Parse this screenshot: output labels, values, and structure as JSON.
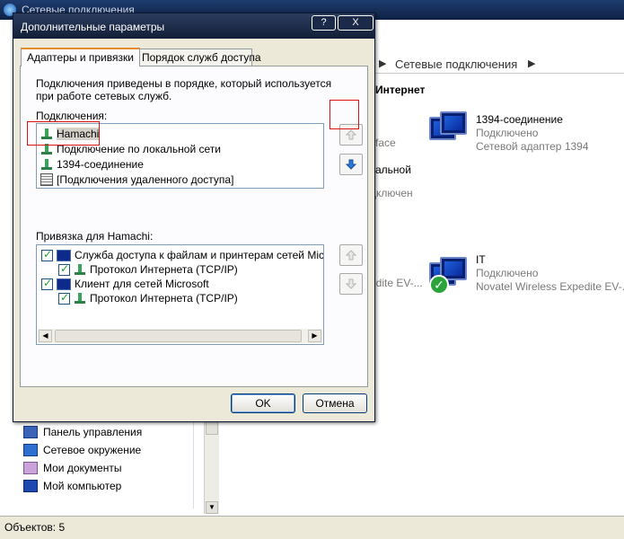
{
  "background_window": {
    "title": "Сетевые подключения",
    "address_path": "Сетевые подключения",
    "section_header": "Интернет",
    "items": [
      {
        "partial_prefix": "rface",
        "name": "1394-соединение",
        "status": "Подключено",
        "device": "Сетевой адаптер 1394"
      },
      {
        "partial_line1": "альной",
        "partial_line2": "дключен"
      },
      {
        "partial_prefix": "edite EV-...",
        "name": "IT",
        "status": "Подключено",
        "device": "Novatel Wireless Expedite EV-..."
      }
    ],
    "left_pane_items": [
      {
        "label": "Панель управления",
        "icon": "control-panel-icon"
      },
      {
        "label": "Сетевое окружение",
        "icon": "network-places-icon"
      },
      {
        "label": "Мои документы",
        "icon": "my-documents-icon"
      },
      {
        "label": "Мой компьютер",
        "icon": "my-computer-icon"
      }
    ],
    "status_bar": "Объектов: 5"
  },
  "dialog": {
    "title": "Дополнительные параметры",
    "help_button": "?",
    "close_button": "X",
    "tabs": [
      {
        "label": "Адаптеры и привязки",
        "active": true
      },
      {
        "label": "Порядок служб доступа",
        "active": false
      }
    ],
    "description": "Подключения приведены в порядке, который используется при работе сетевых служб.",
    "connections_label": "Подключения:",
    "connections": [
      {
        "label": "Hamachi",
        "selected": true,
        "icon": "network-connection-icon"
      },
      {
        "label": "Подключение по локальной сети",
        "icon": "network-connection-icon"
      },
      {
        "label": "1394-соединение",
        "icon": "network-connection-icon"
      },
      {
        "label": "[Подключения удаленного доступа]",
        "icon": "dialup-icon"
      }
    ],
    "binding_label": "Привязка для Hamachi:",
    "bindings": [
      {
        "label": "Служба доступа к файлам и принтерам сетей Microsoft",
        "checked": true,
        "level": 0,
        "icon": "service-icon"
      },
      {
        "label": "Протокол Интернета (TCP/IP)",
        "checked": true,
        "level": 1,
        "icon": "protocol-icon"
      },
      {
        "label": "Клиент для сетей Microsoft",
        "checked": true,
        "level": 0,
        "icon": "client-icon"
      },
      {
        "label": "Протокол Интернета (TCP/IP)",
        "checked": true,
        "level": 1,
        "icon": "protocol-icon"
      }
    ],
    "ok_button": "OK",
    "cancel_button": "Отмена"
  }
}
